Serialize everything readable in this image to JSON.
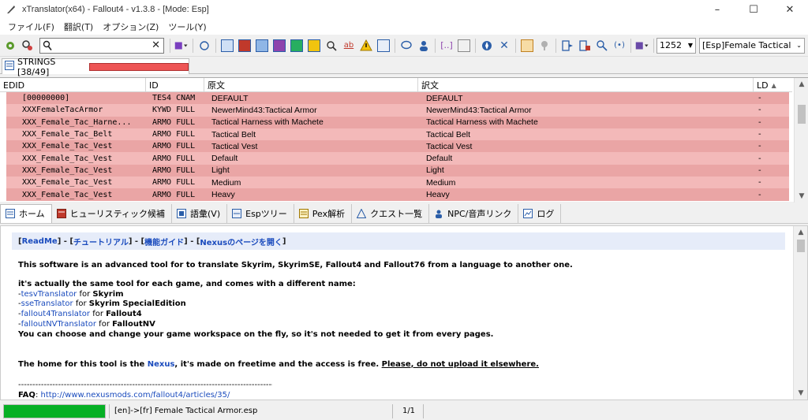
{
  "window": {
    "title": "xTranslator(x64) - Fallout4 - v1.3.8 - [Mode: Esp]",
    "minimize_glyph": "–",
    "maximize_glyph": "☐",
    "close_glyph": "✕"
  },
  "menu": [
    "ファイル(F)",
    "翻訳(T)",
    "オプション(Z)",
    "ツール(Y)"
  ],
  "toolbar": {
    "search_value": "",
    "codepage": "1252",
    "file_combo": "[Esp]Female Tactical Armo"
  },
  "strings_tab": {
    "label": "STRINGS [38/49]",
    "progress_fraction": 1.0
  },
  "grid": {
    "headers": {
      "edid": "EDID",
      "id": "ID",
      "source": "原文",
      "translation": "訳文",
      "ld": "LD"
    },
    "rows": [
      {
        "edid": "[00000000]",
        "id": "TES4 CNAM",
        "source": "DEFAULT",
        "translation": "DEFAULT",
        "ld": "-"
      },
      {
        "edid": "XXXFemaleTacArmor",
        "id": "KYWD FULL",
        "source": "NewerMind43:Tactical Armor",
        "translation": "NewerMind43:Tactical Armor",
        "ld": "-"
      },
      {
        "edid": "XXX_Female_Tac_Harne...",
        "id": "ARMO FULL",
        "source": "Tactical Harness with Machete",
        "translation": "Tactical Harness with Machete",
        "ld": "-"
      },
      {
        "edid": "XXX_Female_Tac_Belt",
        "id": "ARMO FULL",
        "source": "Tactical Belt",
        "translation": "Tactical Belt",
        "ld": "-"
      },
      {
        "edid": "XXX_Female_Tac_Vest",
        "id": "ARMO FULL",
        "source": "Tactical Vest",
        "translation": "Tactical Vest",
        "ld": "-"
      },
      {
        "edid": "XXX_Female_Tac_Vest",
        "id": "ARMO FULL",
        "source": "Default",
        "translation": "Default",
        "ld": "-"
      },
      {
        "edid": "XXX_Female_Tac_Vest",
        "id": "ARMO FULL",
        "source": "Light",
        "translation": "Light",
        "ld": "-"
      },
      {
        "edid": "XXX_Female_Tac_Vest",
        "id": "ARMO FULL",
        "source": "Medium",
        "translation": "Medium",
        "ld": "-"
      },
      {
        "edid": "XXX_Female_Tac_Vest",
        "id": "ARMO FULL",
        "source": "Heavy",
        "translation": "Heavy",
        "ld": "-"
      }
    ]
  },
  "bottom_tabs": [
    {
      "label": "ホーム",
      "icon": "home-icon"
    },
    {
      "label": "ヒューリスティック候補",
      "icon": "heuristic-icon"
    },
    {
      "label": "語彙(V)",
      "icon": "vocabulary-icon"
    },
    {
      "label": "Espツリー",
      "icon": "tree-icon"
    },
    {
      "label": "Pex解析",
      "icon": "pex-icon"
    },
    {
      "label": "クエスト一覧",
      "icon": "quest-icon"
    },
    {
      "label": "NPC/音声リンク",
      "icon": "npc-icon"
    },
    {
      "label": "ログ",
      "icon": "log-icon"
    }
  ],
  "home": {
    "links": {
      "readme": "ReadMe",
      "tutorial": "チュートリアル",
      "guide": "機能ガイド",
      "nexus": "Nexusのページを開く"
    },
    "intro": "This software is an advanced tool for to translate Skyrim, SkyrimSE, Fallout4 and Fallout76 from a language to another one.",
    "same_tool": "it's actually the same tool for each game, and comes with a different name:",
    "tools": [
      {
        "name": "tesvTranslator",
        "game": "Skyrim"
      },
      {
        "name": "sseTranslator",
        "game": "Skyrim SpecialEdition"
      },
      {
        "name": "fallout4Translator",
        "game": "Fallout4"
      },
      {
        "name": "falloutNVTranslator",
        "game": "FalloutNV"
      }
    ],
    "workspace": "You can choose and change your game workspace on the fly, so it's not needed to get it from every pages.",
    "home_prefix": "The home for this tool is the ",
    "home_link": "Nexus",
    "home_mid": ", it's made on freetime and the access is free. ",
    "home_warn": "Please, do not upload it elsewhere.",
    "dashes": "------------------------------------------------------------------------------------------------",
    "faq_label": "FAQ",
    "faq_url": "http://www.nexusmods.com/fallout4/articles/35/"
  },
  "status": {
    "progress_fraction": 1.0,
    "file": "[en]->[fr] Female Tactical Armor.esp",
    "page": "1/1"
  },
  "colors": {
    "row_odd": "#eaa5a5",
    "row_even": "#f3b9b9",
    "strings_progress": "#ee5555",
    "status_progress": "#06b025",
    "link": "#1a4bbd"
  }
}
